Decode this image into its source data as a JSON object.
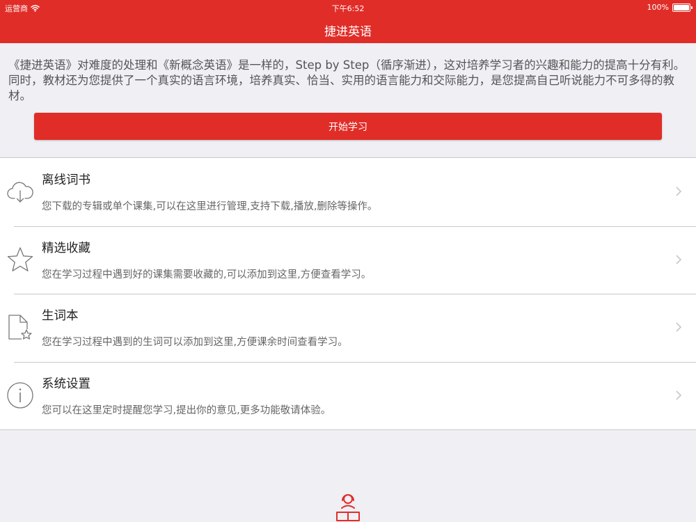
{
  "status_bar": {
    "carrier": "运营商",
    "time": "下午6:52",
    "battery": "100%"
  },
  "nav": {
    "title": "捷进英语"
  },
  "intro": {
    "text": "《捷进英语》对难度的处理和《新概念英语》是一样的，Step by Step（循序渐进），这对培养学习者的兴趣和能力的提高十分有利。同时，教材还为您提供了一个真实的语言环境，培养真实、恰当、实用的语言能力和交际能力，是您提高自己听说能力不可多得的教材。"
  },
  "start_button": {
    "label": "开始学习"
  },
  "menu": {
    "items": [
      {
        "title": "离线词书",
        "desc": "您下载的专辑或单个课集,可以在这里进行管理,支持下载,播放,删除等操作。",
        "icon": "cloud-download-icon"
      },
      {
        "title": "精选收藏",
        "desc": "您在学习过程中遇到好的课集需要收藏的,可以添加到这里,方便查看学习。",
        "icon": "star-icon"
      },
      {
        "title": "生词本",
        "desc": "您在学习过程中遇到的生词可以添加到这里,方便课余时间查看学习。",
        "icon": "document-star-icon"
      },
      {
        "title": "系统设置",
        "desc": "您可以在这里定时提醒您学习,提出你的意见,更多功能敬请体验。",
        "icon": "info-icon"
      }
    ]
  },
  "colors": {
    "accent": "#e12d28",
    "background": "#efeff4"
  }
}
